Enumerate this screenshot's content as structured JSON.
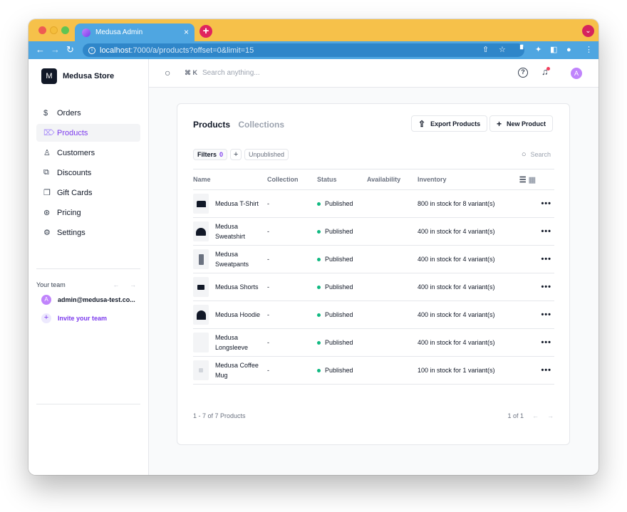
{
  "browser": {
    "tab_title": "Medusa Admin",
    "tab_close": "×",
    "new_tab": "+",
    "url_host": "localhost",
    "url_path": ":7000/a/products?offset=0&limit=15",
    "profile_menu": "⌄"
  },
  "sidebar": {
    "store_logo": "M",
    "store_name": "Medusa Store",
    "items": [
      {
        "label": "Orders",
        "icon": "$"
      },
      {
        "label": "Products",
        "icon": "⌦"
      },
      {
        "label": "Customers",
        "icon": "♙"
      },
      {
        "label": "Discounts",
        "icon": "⧉"
      },
      {
        "label": "Gift Cards",
        "icon": "❒"
      },
      {
        "label": "Pricing",
        "icon": "⊛"
      },
      {
        "label": "Settings",
        "icon": "⚙"
      }
    ],
    "team_label": "Your team",
    "team_arrows": "← →",
    "member_initial": "A",
    "member_email": "admin@medusa-test.co...",
    "invite_icon": "+",
    "invite_label": "Invite your team"
  },
  "topbar": {
    "search_shortcut": "⌘ K",
    "search_placeholder": "Search anything...",
    "help": "?",
    "avatar": "A"
  },
  "main": {
    "tabs": [
      "Products",
      "Collections"
    ],
    "export_label": "Export Products",
    "export_icon": "⇪",
    "new_label": "New Product",
    "new_icon": "+",
    "filters_label": "Filters",
    "filters_count": "0",
    "add_filter": "+",
    "saved_filter": "Unpublished",
    "search_label": "Search",
    "columns": [
      "Name",
      "Collection",
      "Status",
      "Availability",
      "Inventory"
    ],
    "view_list_icon": "☰",
    "view_grid_icon": "▦",
    "rows": [
      {
        "name": "Medusa T-Shirt",
        "collection": "-",
        "status": "Published",
        "inventory": "800 in stock for 8 variant(s)"
      },
      {
        "name": "Medusa Sweatshirt",
        "collection": "-",
        "status": "Published",
        "inventory": "400 in stock for 4 variant(s)"
      },
      {
        "name": "Medusa Sweatpants",
        "collection": "-",
        "status": "Published",
        "inventory": "400 in stock for 4 variant(s)"
      },
      {
        "name": "Medusa Shorts",
        "collection": "-",
        "status": "Published",
        "inventory": "400 in stock for 4 variant(s)"
      },
      {
        "name": "Medusa Hoodie",
        "collection": "-",
        "status": "Published",
        "inventory": "400 in stock for 4 variant(s)"
      },
      {
        "name": "Medusa Longsleeve",
        "collection": "-",
        "status": "Published",
        "inventory": "400 in stock for 4 variant(s)"
      },
      {
        "name": "Medusa Coffee Mug",
        "collection": "-",
        "status": "Published",
        "inventory": "100 in stock for 1 variant(s)"
      }
    ],
    "row_menu": "•••",
    "pager_summary": "1 - 7 of 7 Products",
    "pager_page": "1 of 1",
    "pager_prev": "←",
    "pager_next": "→"
  },
  "colors": {
    "accent": "#7c3aed",
    "titlebar": "#f6c14a",
    "browser_blue": "#4fa6e1",
    "status_published": "#10b981"
  }
}
